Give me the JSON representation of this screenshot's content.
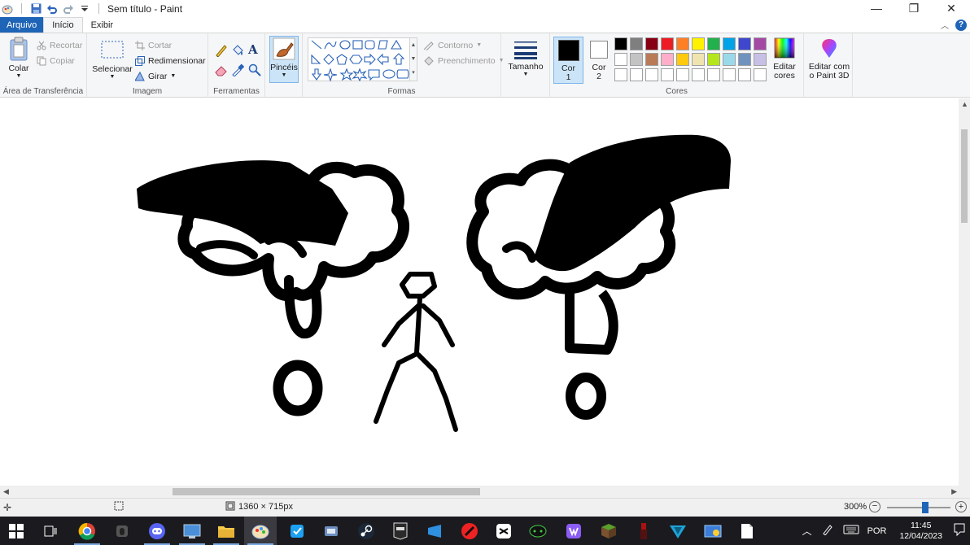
{
  "window": {
    "title": "Sem título - Paint",
    "minimize": "—",
    "restore": "❐",
    "close": "✕"
  },
  "tabs": {
    "file": "Arquivo",
    "home": "Início",
    "view": "Exibir"
  },
  "ribbon": {
    "clipboard": {
      "label": "Área de Transferência",
      "paste": "Colar",
      "cut": "Recortar",
      "copy": "Copiar"
    },
    "image": {
      "label": "Imagem",
      "select": "Selecionar",
      "crop": "Cortar",
      "resize": "Redimensionar",
      "rotate": "Girar"
    },
    "tools": {
      "label": "Ferramentas",
      "text_glyph": "A"
    },
    "brushes": {
      "label": "Pincéis"
    },
    "shapes": {
      "label": "Formas",
      "outline": "Contorno",
      "fill": "Preenchimento"
    },
    "size": {
      "label": "Tamanho"
    },
    "colors": {
      "label": "Cores",
      "color1_line1": "Cor",
      "color1_line2": "1",
      "color2_line1": "Cor",
      "color2_line2": "2",
      "color1": "#000000",
      "color2": "#ffffff",
      "palette_row1": [
        "#000000",
        "#7f7f7f",
        "#880015",
        "#ed1c24",
        "#ff7f27",
        "#fff200",
        "#22b14c",
        "#00a2e8",
        "#3f48cc",
        "#a349a4"
      ],
      "palette_row2": [
        "#ffffff",
        "#c3c3c3",
        "#b97a57",
        "#ffaec9",
        "#ffc90e",
        "#efe4b0",
        "#b5e61d",
        "#99d9ea",
        "#7092be",
        "#c8bfe7"
      ],
      "palette_row3": [
        "#ffffff",
        "#ffffff",
        "#ffffff",
        "#ffffff",
        "#ffffff",
        "#ffffff",
        "#ffffff",
        "#ffffff",
        "#ffffff",
        "#ffffff"
      ],
      "edit_line1": "Editar",
      "edit_line2": "cores"
    },
    "paint3d": {
      "line1": "Editar com",
      "line2": "o Paint 3D"
    }
  },
  "status": {
    "image_size": "1360 × 715px",
    "zoom": "300%"
  },
  "taskbar": {
    "apps": [
      "start-icon",
      "task-view-icon",
      "chrome-icon",
      "app-icon",
      "discord-icon",
      "desktop-app-icon",
      "file-explorer-icon",
      "paint-icon",
      "app-icon",
      "app-icon",
      "steam-icon",
      "epic-games-icon",
      "app-icon",
      "app-icon",
      "capcut-icon",
      "app-icon",
      "app-icon",
      "minecraft-icon",
      "app-icon",
      "app-icon",
      "app-icon",
      "file-icon"
    ],
    "language": "POR",
    "time": "11:45",
    "date": "12/04/2023"
  }
}
